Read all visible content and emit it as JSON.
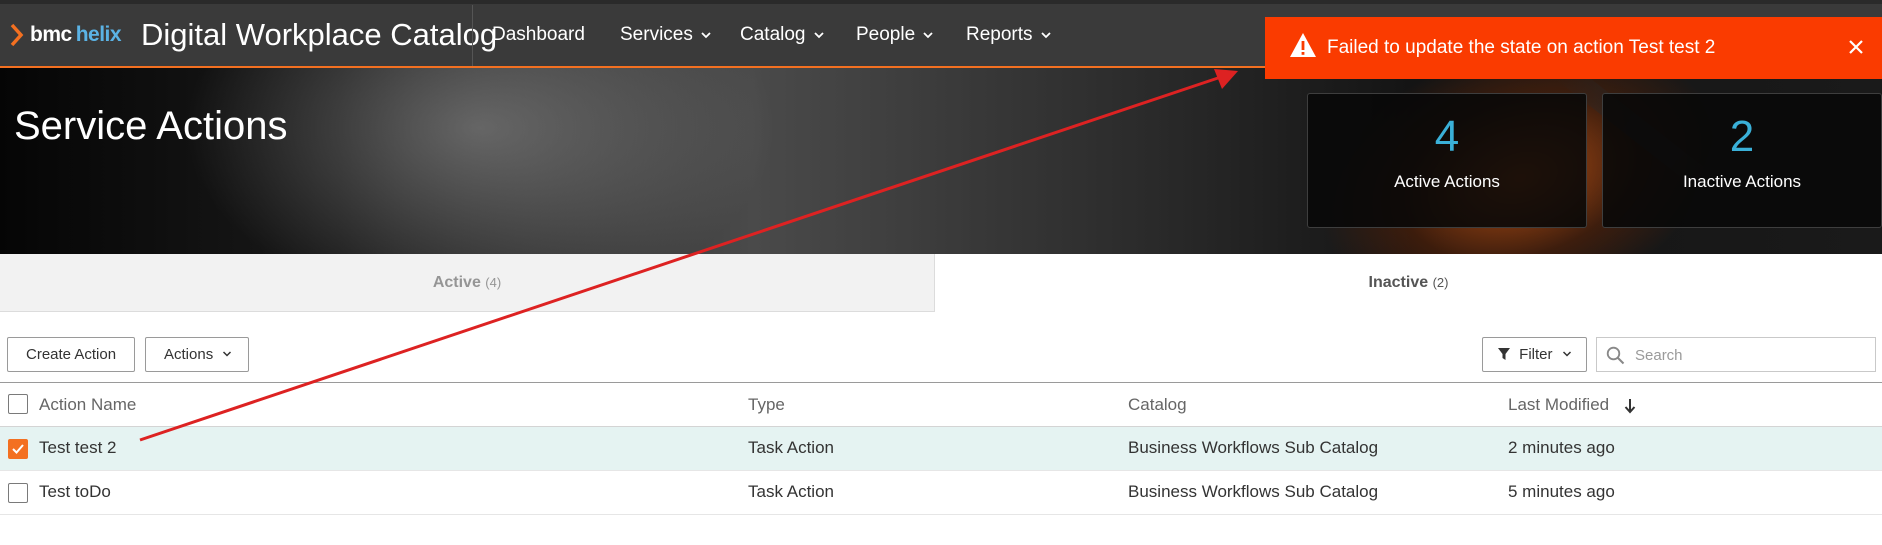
{
  "brand": {
    "bmc": "bmc",
    "helix": "helix",
    "accent": "#f37021",
    "helix_color": "#5bb3e5"
  },
  "app_title": "Digital Workplace Catalog",
  "nav": {
    "dashboard": "Dashboard",
    "services": "Services",
    "catalog": "Catalog",
    "people": "People",
    "reports": "Reports"
  },
  "toast": {
    "message": "Failed to update the state on action Test test 2",
    "color": "#fa3b00",
    "icon": "warning-icon"
  },
  "page_title": "Service Actions",
  "stats": {
    "active": {
      "value": "4",
      "label": "Active Actions"
    },
    "inactive": {
      "value": "2",
      "label": "Inactive Actions"
    },
    "value_color": "#3ab0d8"
  },
  "tabs": {
    "active": {
      "label": "Active",
      "count": "(4)"
    },
    "inactive": {
      "label": "Inactive",
      "count": "(2)"
    },
    "selected": "inactive"
  },
  "toolbar": {
    "create_label": "Create Action",
    "actions_label": "Actions",
    "filter_label": "Filter",
    "search_placeholder": "Search"
  },
  "table": {
    "columns": [
      "Action Name",
      "Type",
      "Catalog",
      "Last Modified"
    ],
    "sort": {
      "column": "Last Modified",
      "direction": "descending"
    },
    "rows": [
      {
        "name": "Test test 2",
        "type": "Task Action",
        "catalog": "Business Workflows Sub Catalog",
        "modified": "2 minutes ago",
        "checked": true
      },
      {
        "name": "Test toDo",
        "type": "Task Action",
        "catalog": "Business Workflows Sub Catalog",
        "modified": "5 minutes ago",
        "checked": false
      }
    ]
  },
  "annotation": {
    "color": "#dd2222"
  }
}
